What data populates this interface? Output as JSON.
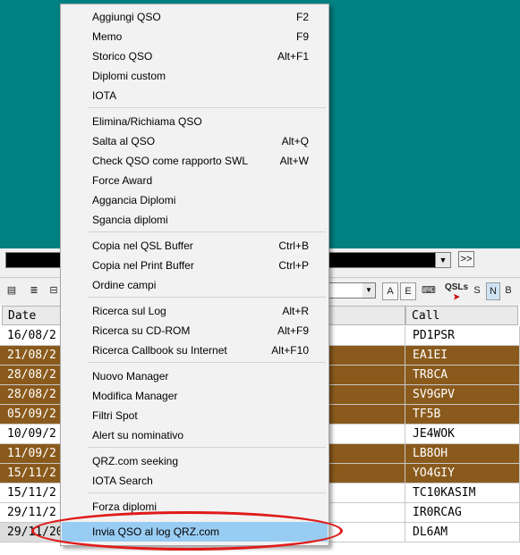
{
  "colors": {
    "teal_background": "#008080",
    "highlight": "#99ccf2",
    "row_brown": "#8a5a1c",
    "annotation_red": "#e01a1a"
  },
  "top_combo": {
    "value": ""
  },
  "toolbar": {
    "btn_a": "A",
    "btn_e": "E",
    "qsl_label": "QSLs",
    "btn_s": "S",
    "btn_n": "N",
    "btn_b": "B",
    "ff_label": ">>"
  },
  "grid": {
    "headers": {
      "date": "Date",
      "call": "Call"
    },
    "rows": [
      {
        "date": "16/08/2",
        "call": "PD1PSR",
        "style": "white"
      },
      {
        "date": "21/08/2",
        "call": "EA1EI",
        "style": "brown"
      },
      {
        "date": "28/08/2",
        "call": "TR8CA",
        "style": "brown"
      },
      {
        "date": "28/08/2",
        "call": "SV9GPV",
        "style": "brown"
      },
      {
        "date": "05/09/2",
        "call": "TF5B",
        "style": "brown"
      },
      {
        "date": "10/09/2",
        "call": "JE4WOK",
        "style": "white"
      },
      {
        "date": "11/09/2",
        "call": "LB8OH",
        "style": "brown"
      },
      {
        "date": "15/11/2",
        "call": "YO4GIY",
        "style": "brown"
      },
      {
        "date": "15/11/2",
        "call": "TC10KASIM",
        "style": "white"
      },
      {
        "date": "29/11/2",
        "call": "IR0RCAG",
        "style": "white"
      },
      {
        "date": "29/11/202",
        "call": "DL6AM",
        "style": "white"
      }
    ]
  },
  "menu": {
    "items": [
      {
        "label": "Aggiungi QSO",
        "shortcut": "F2"
      },
      {
        "label": "Memo",
        "shortcut": "F9"
      },
      {
        "label": "Storico QSO",
        "shortcut": "Alt+F1"
      },
      {
        "label": "Diplomi custom",
        "shortcut": ""
      },
      {
        "label": "IOTA",
        "shortcut": ""
      },
      {
        "label": "Elimina/Richiama QSO",
        "shortcut": ""
      },
      {
        "label": "Salta al QSO",
        "shortcut": "Alt+Q"
      },
      {
        "label": "Check QSO come rapporto SWL",
        "shortcut": "Alt+W"
      },
      {
        "label": "Force Award",
        "shortcut": ""
      },
      {
        "label": "Aggancia Diplomi",
        "shortcut": ""
      },
      {
        "label": "Sgancia diplomi",
        "shortcut": ""
      },
      {
        "label": "Copia nel QSL Buffer",
        "shortcut": "Ctrl+B"
      },
      {
        "label": "Copia nel Print Buffer",
        "shortcut": "Ctrl+P"
      },
      {
        "label": "Ordine campi",
        "shortcut": ""
      },
      {
        "label": "Ricerca sul Log",
        "shortcut": "Alt+R"
      },
      {
        "label": "Ricerca su CD-ROM",
        "shortcut": "Alt+F9"
      },
      {
        "label": "Ricerca Callbook su Internet",
        "shortcut": "Alt+F10"
      },
      {
        "label": "Nuovo Manager",
        "shortcut": ""
      },
      {
        "label": "Modifica Manager",
        "shortcut": ""
      },
      {
        "label": "Filtri Spot",
        "shortcut": ""
      },
      {
        "label": "Alert su nominativo",
        "shortcut": ""
      },
      {
        "label": "QRZ.com seeking",
        "shortcut": ""
      },
      {
        "label": "IOTA Search",
        "shortcut": ""
      },
      {
        "label": "Forza diplomi",
        "shortcut": ""
      },
      {
        "label": "Invia QSO al log QRZ.com",
        "shortcut": ""
      }
    ]
  }
}
